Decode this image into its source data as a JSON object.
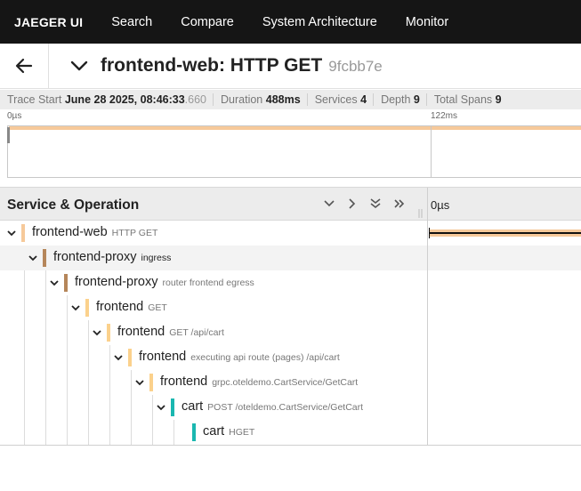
{
  "nav": {
    "brand": "JAEGER UI",
    "links": [
      "Search",
      "Compare",
      "System Architecture",
      "Monitor"
    ]
  },
  "trace": {
    "title": "frontend-web: HTTP GET",
    "id": "9fcbb7e"
  },
  "meta": {
    "trace_start_label": "Trace Start",
    "trace_start_value": "June 28 2025, 08:46:33",
    "trace_start_ms": ".660",
    "duration_label": "Duration",
    "duration_value": "488ms",
    "services_label": "Services",
    "services_value": "4",
    "depth_label": "Depth",
    "depth_value": "9",
    "total_spans_label": "Total Spans",
    "total_spans_value": "9"
  },
  "minimap": {
    "ticks": [
      "0µs",
      "122ms"
    ]
  },
  "table": {
    "header_title": "Service & Operation",
    "timeline_start": "0µs"
  },
  "colors": {
    "frontend_web": "#f6c99a",
    "frontend_proxy": "#b5865a",
    "frontend": "#fbd18c",
    "cart": "#1ab7b0"
  },
  "spans": [
    {
      "service": "frontend-web",
      "operation": "HTTP GET"
    },
    {
      "service": "frontend-proxy",
      "operation": "ingress"
    },
    {
      "service": "frontend-proxy",
      "operation": "router frontend egress"
    },
    {
      "service": "frontend",
      "operation": "GET"
    },
    {
      "service": "frontend",
      "operation": "GET /api/cart"
    },
    {
      "service": "frontend",
      "operation": "executing api route (pages) /api/cart"
    },
    {
      "service": "frontend",
      "operation": "grpc.oteldemo.CartService/GetCart"
    },
    {
      "service": "cart",
      "operation": "POST /oteldemo.CartService/GetCart"
    },
    {
      "service": "cart",
      "operation": "HGET"
    }
  ]
}
